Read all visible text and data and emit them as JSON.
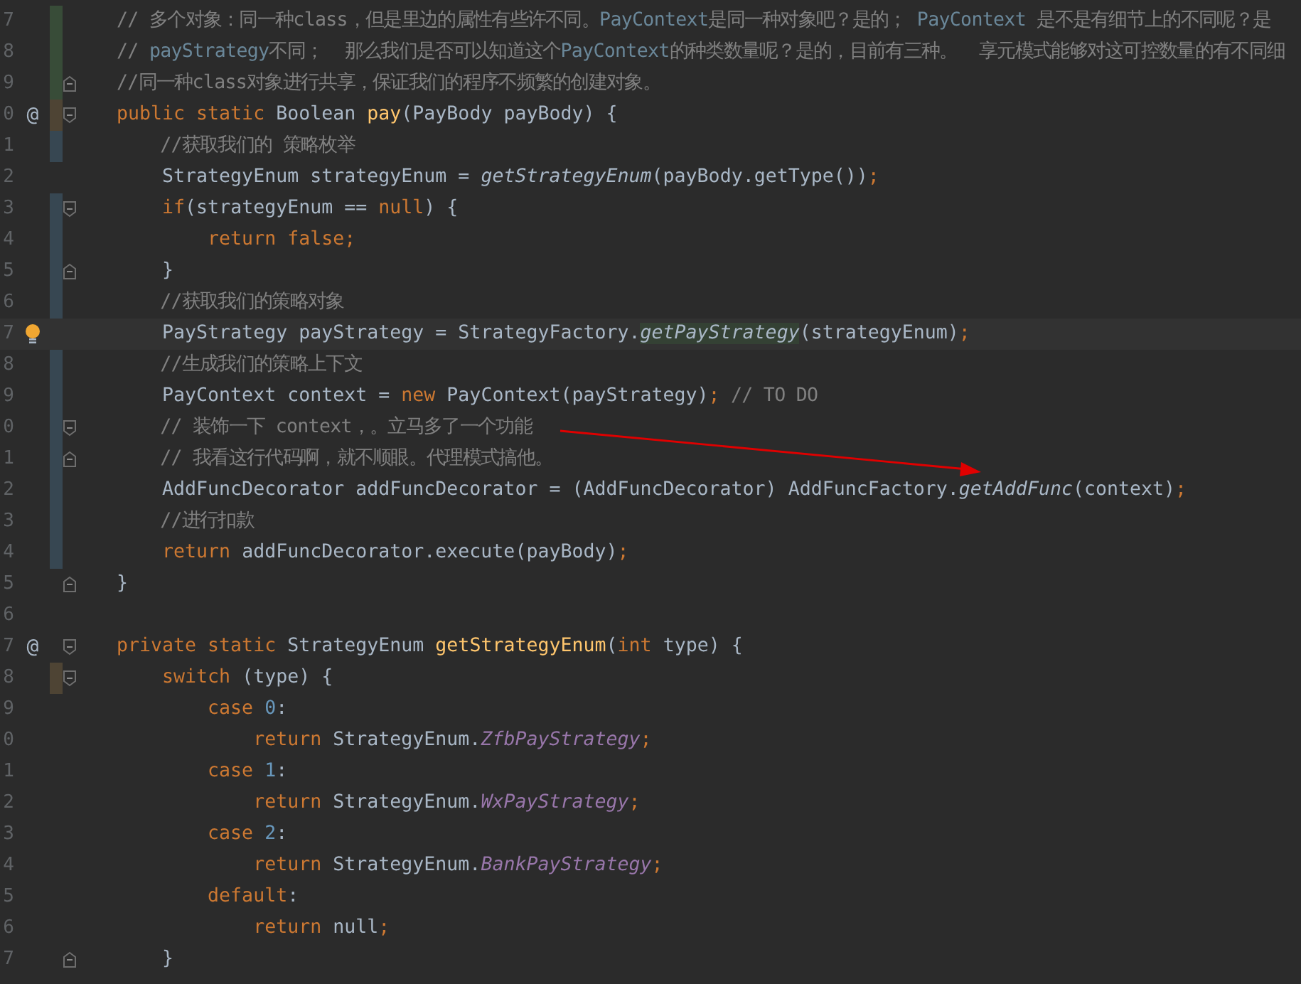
{
  "editor": {
    "lines": [
      {
        "number": "7",
        "color": "#384c38",
        "tokens": [
          {
            "kind": "comment",
            "text": "// 多个对象：同一种class，但是里边的属性有些许不同。"
          },
          {
            "kind": "comment_ref",
            "text": "PayContext"
          },
          {
            "kind": "comment",
            "text": "是同一种对象吧？是的； "
          },
          {
            "kind": "comment_ref",
            "text": "PayContext"
          },
          {
            "kind": "comment",
            "text": " 是不是有细节上的不同呢？是"
          }
        ]
      },
      {
        "number": "8",
        "color": "#384c38",
        "tokens": [
          {
            "kind": "comment",
            "text": "// "
          },
          {
            "kind": "comment_ref",
            "text": "payStrategy"
          },
          {
            "kind": "comment",
            "text": "不同；  那么我们是否可以知道这个"
          },
          {
            "kind": "comment_ref",
            "text": "PayContext"
          },
          {
            "kind": "comment",
            "text": "的种类数量呢？是的，目前有三种。  享元模式能够对这可控数量的有不同细"
          }
        ]
      },
      {
        "number": "9",
        "color": "#384c38",
        "fold_end": true,
        "tokens": [
          {
            "kind": "comment",
            "text": "//同一种class对象进行共享，保证我们的程序不频繁的创建对象。"
          }
        ]
      },
      {
        "number": "0",
        "color": "#4e4434",
        "gutter": "@",
        "fold_start": true,
        "tokens": [
          {
            "kind": "keyword",
            "text": "public static "
          },
          {
            "kind": "plain",
            "text": "Boolean "
          },
          {
            "kind": "method_decl",
            "text": "pay"
          },
          {
            "kind": "plain",
            "text": "(PayBody payBody) {"
          }
        ]
      },
      {
        "number": "1",
        "color": "#374752",
        "tokens": [
          {
            "kind": "comment",
            "text": "    //获取我们的 策略枚举"
          }
        ]
      },
      {
        "number": "2",
        "tokens": [
          {
            "kind": "plain",
            "text": "    StrategyEnum strategyEnum = "
          },
          {
            "kind": "static_call",
            "text": "getStrategyEnum"
          },
          {
            "kind": "plain",
            "text": "(payBody.getType())"
          },
          {
            "kind": "keyword",
            "text": ";"
          }
        ]
      },
      {
        "number": "3",
        "color": "#374752",
        "fold_start": true,
        "tokens": [
          {
            "kind": "keyword",
            "text": "    if"
          },
          {
            "kind": "plain",
            "text": "(strategyEnum == "
          },
          {
            "kind": "keyword",
            "text": "null"
          },
          {
            "kind": "plain",
            "text": ") {"
          }
        ]
      },
      {
        "number": "4",
        "color": "#374752",
        "tokens": [
          {
            "kind": "keyword",
            "text": "        return false;"
          }
        ]
      },
      {
        "number": "5",
        "color": "#374752",
        "fold_end": true,
        "tokens": [
          {
            "kind": "plain",
            "text": "    }"
          }
        ]
      },
      {
        "number": "6",
        "color": "#374752",
        "tokens": [
          {
            "kind": "comment",
            "text": "    //获取我们的策略对象"
          }
        ]
      },
      {
        "number": "7",
        "current": true,
        "bulb": true,
        "tokens": [
          {
            "kind": "plain",
            "text": "    PayStrategy payStrategy = StrategyFactory."
          },
          {
            "kind": "static_call_hl",
            "text": "getPayStrategy"
          },
          {
            "kind": "plain",
            "text": "(strategyEnum)"
          },
          {
            "kind": "keyword",
            "text": ";"
          }
        ]
      },
      {
        "number": "8",
        "color": "#374752",
        "tokens": [
          {
            "kind": "comment",
            "text": "    //生成我们的策略上下文"
          }
        ]
      },
      {
        "number": "9",
        "color": "#374752",
        "tokens": [
          {
            "kind": "plain",
            "text": "    PayContext context = "
          },
          {
            "kind": "keyword",
            "text": "new "
          },
          {
            "kind": "plain",
            "text": "PayContext(payStrategy)"
          },
          {
            "kind": "keyword",
            "text": ";"
          },
          {
            "kind": "comment",
            "text": " // TO DO"
          }
        ]
      },
      {
        "number": "0",
        "color": "#374752",
        "fold_start": true,
        "tokens": [
          {
            "kind": "comment",
            "text": "    // 装饰一下 context，。立马多了一个功能"
          }
        ]
      },
      {
        "number": "1",
        "color": "#374752",
        "fold_end": true,
        "tokens": [
          {
            "kind": "comment",
            "text": "    // 我看这行代码啊，就不顺眼。代理模式搞他。"
          }
        ]
      },
      {
        "number": "2",
        "color": "#374752",
        "tokens": [
          {
            "kind": "plain",
            "text": "    AddFuncDecorator addFuncDecorator = (AddFuncDecorator) AddFuncFactory."
          },
          {
            "kind": "static_call",
            "text": "getAddFunc"
          },
          {
            "kind": "plain",
            "text": "(context)"
          },
          {
            "kind": "keyword",
            "text": ";"
          }
        ]
      },
      {
        "number": "3",
        "color": "#374752",
        "tokens": [
          {
            "kind": "comment",
            "text": "    //进行扣款"
          }
        ]
      },
      {
        "number": "4",
        "color": "#374752",
        "tokens": [
          {
            "kind": "keyword",
            "text": "    return "
          },
          {
            "kind": "plain",
            "text": "addFuncDecorator.execute(payBody)"
          },
          {
            "kind": "keyword",
            "text": ";"
          }
        ]
      },
      {
        "number": "5",
        "fold_end": true,
        "tokens": [
          {
            "kind": "plain",
            "text": "}"
          }
        ]
      },
      {
        "number": "6"
      },
      {
        "number": "7",
        "gutter": "@",
        "fold_start": true,
        "tokens": [
          {
            "kind": "keyword",
            "text": "private static "
          },
          {
            "kind": "plain",
            "text": "StrategyEnum "
          },
          {
            "kind": "method_decl",
            "text": "getStrategyEnum"
          },
          {
            "kind": "plain",
            "text": "("
          },
          {
            "kind": "keyword",
            "text": "int "
          },
          {
            "kind": "plain",
            "text": "type) {"
          }
        ]
      },
      {
        "number": "8",
        "color": "#4e4434",
        "fold_start": true,
        "tokens": [
          {
            "kind": "keyword",
            "text": "    switch "
          },
          {
            "kind": "plain",
            "text": "(type) {"
          }
        ]
      },
      {
        "number": "9",
        "tokens": [
          {
            "kind": "keyword",
            "text": "        case "
          },
          {
            "kind": "number",
            "text": "0"
          },
          {
            "kind": "plain",
            "text": ":"
          }
        ]
      },
      {
        "number": "0",
        "tokens": [
          {
            "kind": "keyword",
            "text": "            return "
          },
          {
            "kind": "plain",
            "text": "StrategyEnum."
          },
          {
            "kind": "static_field",
            "text": "ZfbPayStrategy"
          },
          {
            "kind": "keyword",
            "text": ";"
          }
        ]
      },
      {
        "number": "1",
        "tokens": [
          {
            "kind": "keyword",
            "text": "        case "
          },
          {
            "kind": "number",
            "text": "1"
          },
          {
            "kind": "plain",
            "text": ":"
          }
        ]
      },
      {
        "number": "2",
        "tokens": [
          {
            "kind": "keyword",
            "text": "            return "
          },
          {
            "kind": "plain",
            "text": "StrategyEnum."
          },
          {
            "kind": "static_field",
            "text": "WxPayStrategy"
          },
          {
            "kind": "keyword",
            "text": ";"
          }
        ]
      },
      {
        "number": "3",
        "tokens": [
          {
            "kind": "keyword",
            "text": "        case "
          },
          {
            "kind": "number",
            "text": "2"
          },
          {
            "kind": "plain",
            "text": ":"
          }
        ]
      },
      {
        "number": "4",
        "tokens": [
          {
            "kind": "keyword",
            "text": "            return "
          },
          {
            "kind": "plain",
            "text": "StrategyEnum."
          },
          {
            "kind": "static_field",
            "text": "BankPayStrategy"
          },
          {
            "kind": "keyword",
            "text": ";"
          }
        ]
      },
      {
        "number": "5",
        "tokens": [
          {
            "kind": "keyword",
            "text": "        default"
          },
          {
            "kind": "plain",
            "text": ":"
          }
        ]
      },
      {
        "number": "6",
        "tokens": [
          {
            "kind": "keyword",
            "text": "            return "
          },
          {
            "kind": "plain",
            "text": "null"
          },
          {
            "kind": "keyword",
            "text": ";"
          }
        ]
      },
      {
        "number": "7",
        "fold_end": true,
        "tokens": [
          {
            "kind": "plain",
            "text": "    }"
          }
        ]
      }
    ]
  }
}
